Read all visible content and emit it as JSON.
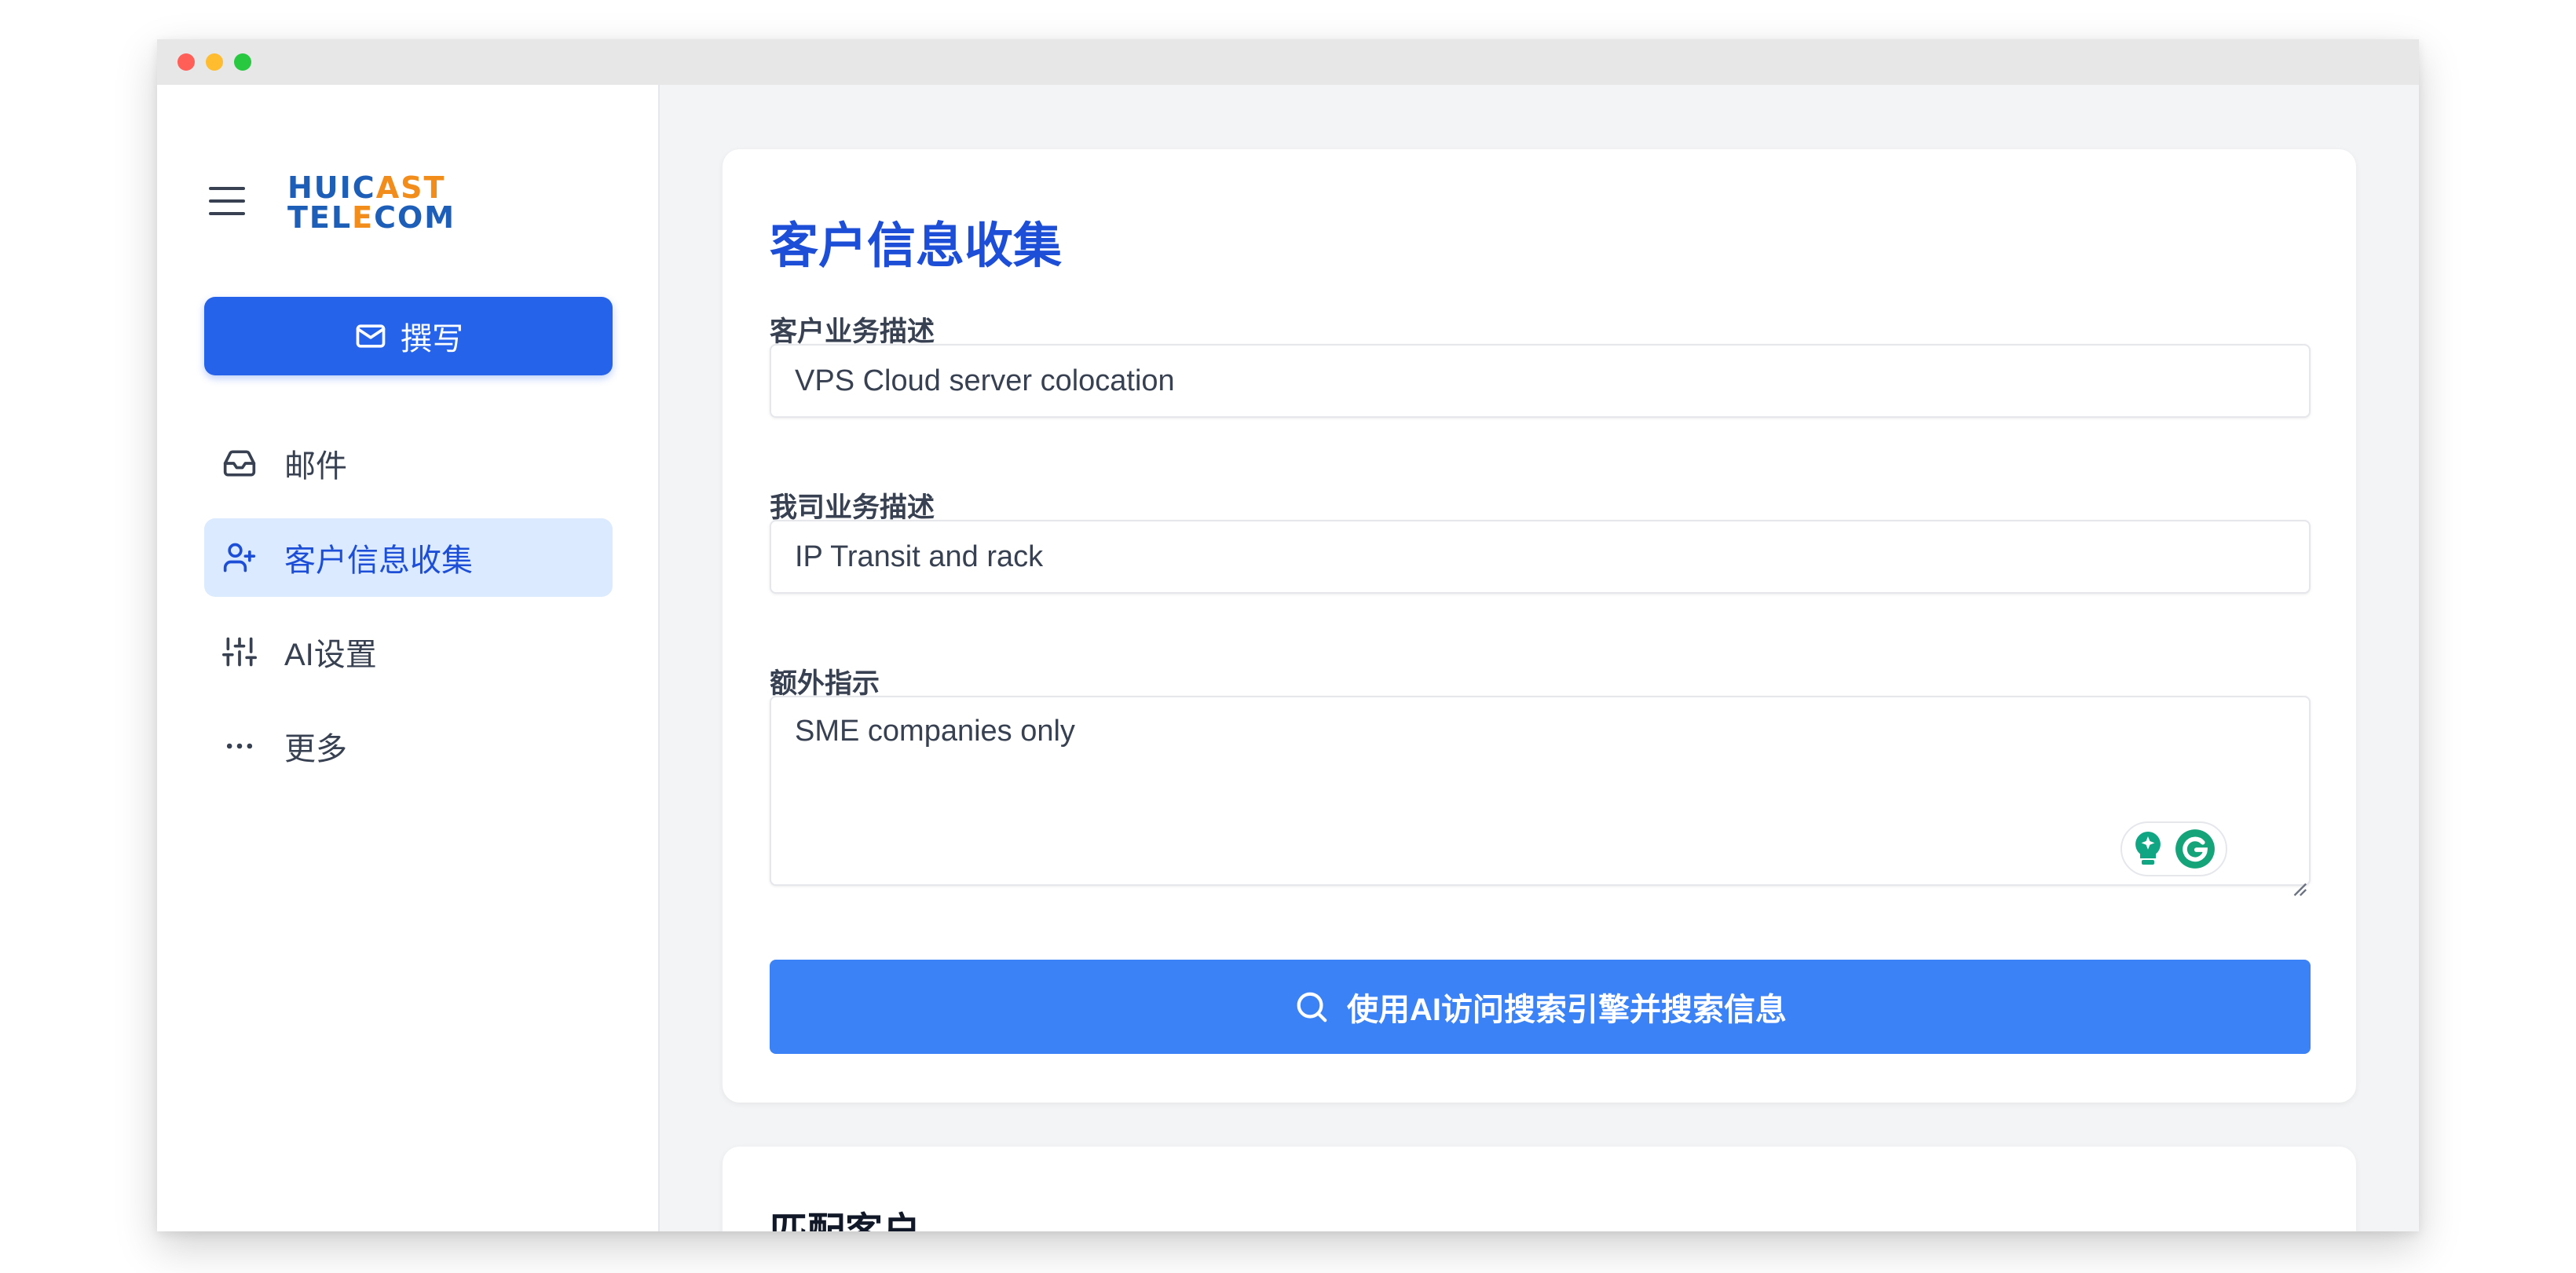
{
  "brand": {
    "logo_line1_a": "HUIC",
    "logo_line1_b": "AST",
    "logo_line2_a": "TEL",
    "logo_line2_b": "E",
    "logo_line2_c": "COM",
    "colors": {
      "blue": "#1d5fb8",
      "orange": "#f28c1a"
    }
  },
  "sidebar": {
    "compose_label": "撰写",
    "items": [
      {
        "label": "邮件",
        "icon": "inbox-icon",
        "active": false
      },
      {
        "label": "客户信息收集",
        "icon": "user-plus-icon",
        "active": true
      },
      {
        "label": "AI设置",
        "icon": "sliders-icon",
        "active": false
      },
      {
        "label": "更多",
        "icon": "more-horizontal-icon",
        "active": false
      }
    ]
  },
  "main": {
    "title": "客户信息收集",
    "fields": {
      "customer_business": {
        "label": "客户业务描述",
        "value": "VPS Cloud server colocation"
      },
      "our_business": {
        "label": "我司业务描述",
        "value": "IP Transit and rack"
      },
      "extra_instructions": {
        "label": "额外指示",
        "value": "SME companies only"
      }
    },
    "search_button_label": "使用AI访问搜索引擎并搜索信息"
  },
  "matched": {
    "title": "匹配客户"
  },
  "colors": {
    "primary": "#2563eb",
    "search_button": "#3b82f6",
    "active_nav_bg": "#dbeafe",
    "title": "#1d4ed8"
  }
}
